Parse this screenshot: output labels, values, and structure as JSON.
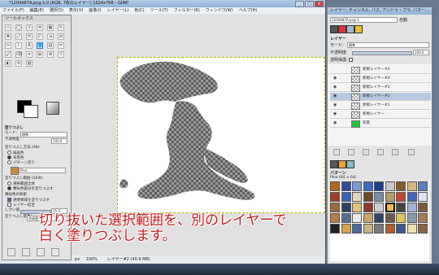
{
  "main_window": {
    "title": "*1204A87A.png-1.0 (RGB, 7枚のレイヤー) 1024x768 – GIMP",
    "controls": {
      "minimize": "_",
      "maximize": "□",
      "close": "×"
    }
  },
  "menubar": [
    "ファイル(F)",
    "編集(E)",
    "選択(S)",
    "表示(V)",
    "画像(I)",
    "レイヤー(L)",
    "色(C)",
    "ツール(T)",
    "フィルター(R)",
    "ウィンドウ(W)",
    "ヘルプ(H)"
  ],
  "toolbox": {
    "title": "ツールボックス",
    "tools": [
      "▭",
      "◯",
      "ℓ",
      "✲",
      "▦",
      "✎",
      "✥",
      "⤢",
      "⟳",
      "◸",
      "⇲",
      "⇄",
      "✂",
      "⌇",
      "A",
      "🪣",
      "▤",
      "✏",
      "🖌",
      "⌫",
      "✦",
      "◍",
      "⊕",
      "☉",
      "◐",
      "⟲",
      "▧"
    ],
    "options_title": "塗りつぶし",
    "mode_label": "モード:",
    "mode_value": "標準",
    "opacity_label": "不透明度",
    "opacity_value": "100.0",
    "fill_type_label": "塗りつぶし方法 (Alt)",
    "fill_type_options": [
      "描画色",
      "背景色",
      "パターン塗り"
    ],
    "pattern_name": "Pine",
    "area_label": "塗りつぶし範囲 (Shift)",
    "area_options": [
      "選択範囲全体",
      "類似色部分を塗りつぶす"
    ],
    "similar_label": "類似色の探索",
    "similar_options": [
      "透明領域を塗りつぶす",
      "レイヤー結合"
    ],
    "threshold_label": "しきい値",
    "threshold_value": "15.0",
    "fill_by_label": "塗りつぶし基準:",
    "fill_by_value": "合成値"
  },
  "statusbar": {
    "unit": "px",
    "zoom": "100%",
    "layer": "レイヤー#2 (40.9 MB)"
  },
  "dock": {
    "title": "レイヤー, チャンネル, パス, アンドゥ・プラ, パター…",
    "image_selector": "1204A87A.png-1",
    "auto_label": "自動",
    "layers_tab": "レイヤー",
    "mode_label": "モード:",
    "mode_value": "標準",
    "opacity_label": "不透明度",
    "opacity_value": "100.0",
    "lock_label": "透明保護:",
    "layers": [
      {
        "name": "新規レイヤー#3",
        "visible": false,
        "selected": false
      },
      {
        "name": "新規レイヤー#4",
        "visible": true,
        "selected": false
      },
      {
        "name": "新規レイヤー#3",
        "visible": true,
        "selected": false
      },
      {
        "name": "新規レイヤー#2",
        "visible": true,
        "selected": true
      },
      {
        "name": "新規レイヤー#1",
        "visible": true,
        "selected": false
      },
      {
        "name": "新規レイヤー",
        "visible": true,
        "selected": false
      },
      {
        "name": "背景",
        "visible": true,
        "selected": false
      }
    ],
    "patterns_tab": "パターン",
    "patterns_selected": "Pine (64 × 64)"
  },
  "caption": {
    "line1": "切り抜いた選択範囲を、別のレイヤーで",
    "line2": "白く塗りつぶします。"
  },
  "colors": {
    "caption": "#c31a1a",
    "selection": "#b4b400",
    "accent": "#3b6fb0"
  }
}
